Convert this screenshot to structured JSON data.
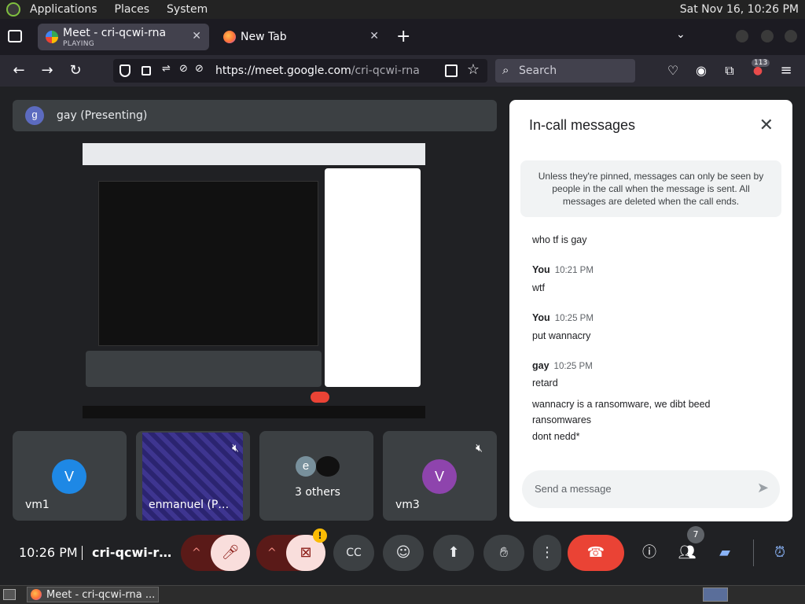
{
  "panel": {
    "menus": [
      "Applications",
      "Places",
      "System"
    ],
    "clock": "Sat Nov 16, 10:26 PM"
  },
  "tabs": [
    {
      "title": "Meet - cri-qcwi-rna",
      "status": "PLAYING"
    },
    {
      "title": "New Tab"
    }
  ],
  "navbar": {
    "url_host": "https://meet.google.com",
    "url_path": "/cri-qcwi-rna",
    "search_placeholder": "Search",
    "extensions_badge": "113"
  },
  "meet": {
    "presenter_initial": "g",
    "presenting_label": "gay (Presenting)",
    "tiles": [
      {
        "name": "vm1",
        "initial": "V"
      },
      {
        "name": "enmanuel (P…"
      },
      {
        "name": "3 others",
        "initial": "e"
      },
      {
        "name": "vm3",
        "initial": "V"
      }
    ],
    "meeting_time": "10:26 PM",
    "meeting_code": "cri-qcwi-r…",
    "participant_count": "7",
    "camera_warning": "!"
  },
  "chat": {
    "title": "In-call messages",
    "notice": "Unless they're pinned, messages can only be seen by people in the call when the message is sent. All messages are deleted when the call ends.",
    "messages": [
      {
        "text": "who tf is gay"
      },
      {
        "sender": "You",
        "time": "10:21 PM",
        "text": "wtf"
      },
      {
        "sender": "You",
        "time": "10:25 PM",
        "text": "put wannacry"
      },
      {
        "sender": "gay",
        "time": "10:25 PM",
        "text": "retard"
      },
      {
        "text": "wannacry is a ransomware, we dibt beed ransomwares"
      },
      {
        "text": "dont nedd*"
      }
    ],
    "input_placeholder": "Send a message"
  },
  "taskbar": {
    "window_title": "Meet - cri-qcwi-rna ..."
  },
  "colors": {
    "end_call": "#ea4335",
    "accent_blue": "#8ab4f8",
    "muted_red": "#f9dedc"
  }
}
